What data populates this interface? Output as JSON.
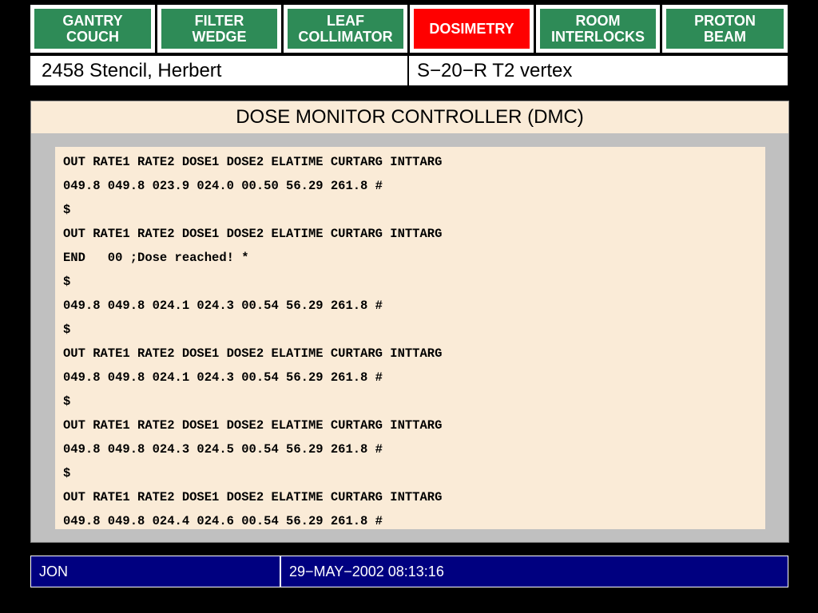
{
  "tabs": [
    {
      "label": "GANTRY\nCOUCH",
      "color": "#2e8b57",
      "active": false
    },
    {
      "label": "FILTER\nWEDGE",
      "color": "#2e8b57",
      "active": false
    },
    {
      "label": "LEAF\nCOLLIMATOR",
      "color": "#2e8b57",
      "active": false
    },
    {
      "label": "DOSIMETRY",
      "color": "#ff0000",
      "active": true
    },
    {
      "label": "ROOM\nINTERLOCKS",
      "color": "#2e8b57",
      "active": false
    },
    {
      "label": "PROTON\nBEAM",
      "color": "#2e8b57",
      "active": false
    }
  ],
  "patient": {
    "id_name": "2458 Stencil, Herbert",
    "field": "S−20−R T2 vertex"
  },
  "panel": {
    "title": "DOSE MONITOR CONTROLLER (DMC)",
    "lines": [
      "OUT RATE1 RATE2 DOSE1 DOSE2 ELATIME CURTARG INTTARG",
      "049.8 049.8 023.9 024.0 00.50 56.29 261.8 #",
      "$",
      "OUT RATE1 RATE2 DOSE1 DOSE2 ELATIME CURTARG INTTARG",
      "END   00 ;Dose reached! *",
      "$",
      "049.8 049.8 024.1 024.3 00.54 56.29 261.8 #",
      "$",
      "OUT RATE1 RATE2 DOSE1 DOSE2 ELATIME CURTARG INTTARG",
      "049.8 049.8 024.1 024.3 00.54 56.29 261.8 #",
      "$",
      "OUT RATE1 RATE2 DOSE1 DOSE2 ELATIME CURTARG INTTARG",
      "049.8 049.8 024.3 024.5 00.54 56.29 261.8 #",
      "$",
      "OUT RATE1 RATE2 DOSE1 DOSE2 ELATIME CURTARG INTTARG",
      "049.8 049.8 024.4 024.6 00.54 56.29 261.8 #"
    ]
  },
  "status": {
    "user": "JON",
    "datetime": "29−MAY−2002 08:13:16"
  },
  "colors": {
    "background": "#000000",
    "tab_inactive": "#2e8b57",
    "tab_active": "#ff0000",
    "panel_bg": "#faebd7",
    "status_bg": "#000080"
  }
}
